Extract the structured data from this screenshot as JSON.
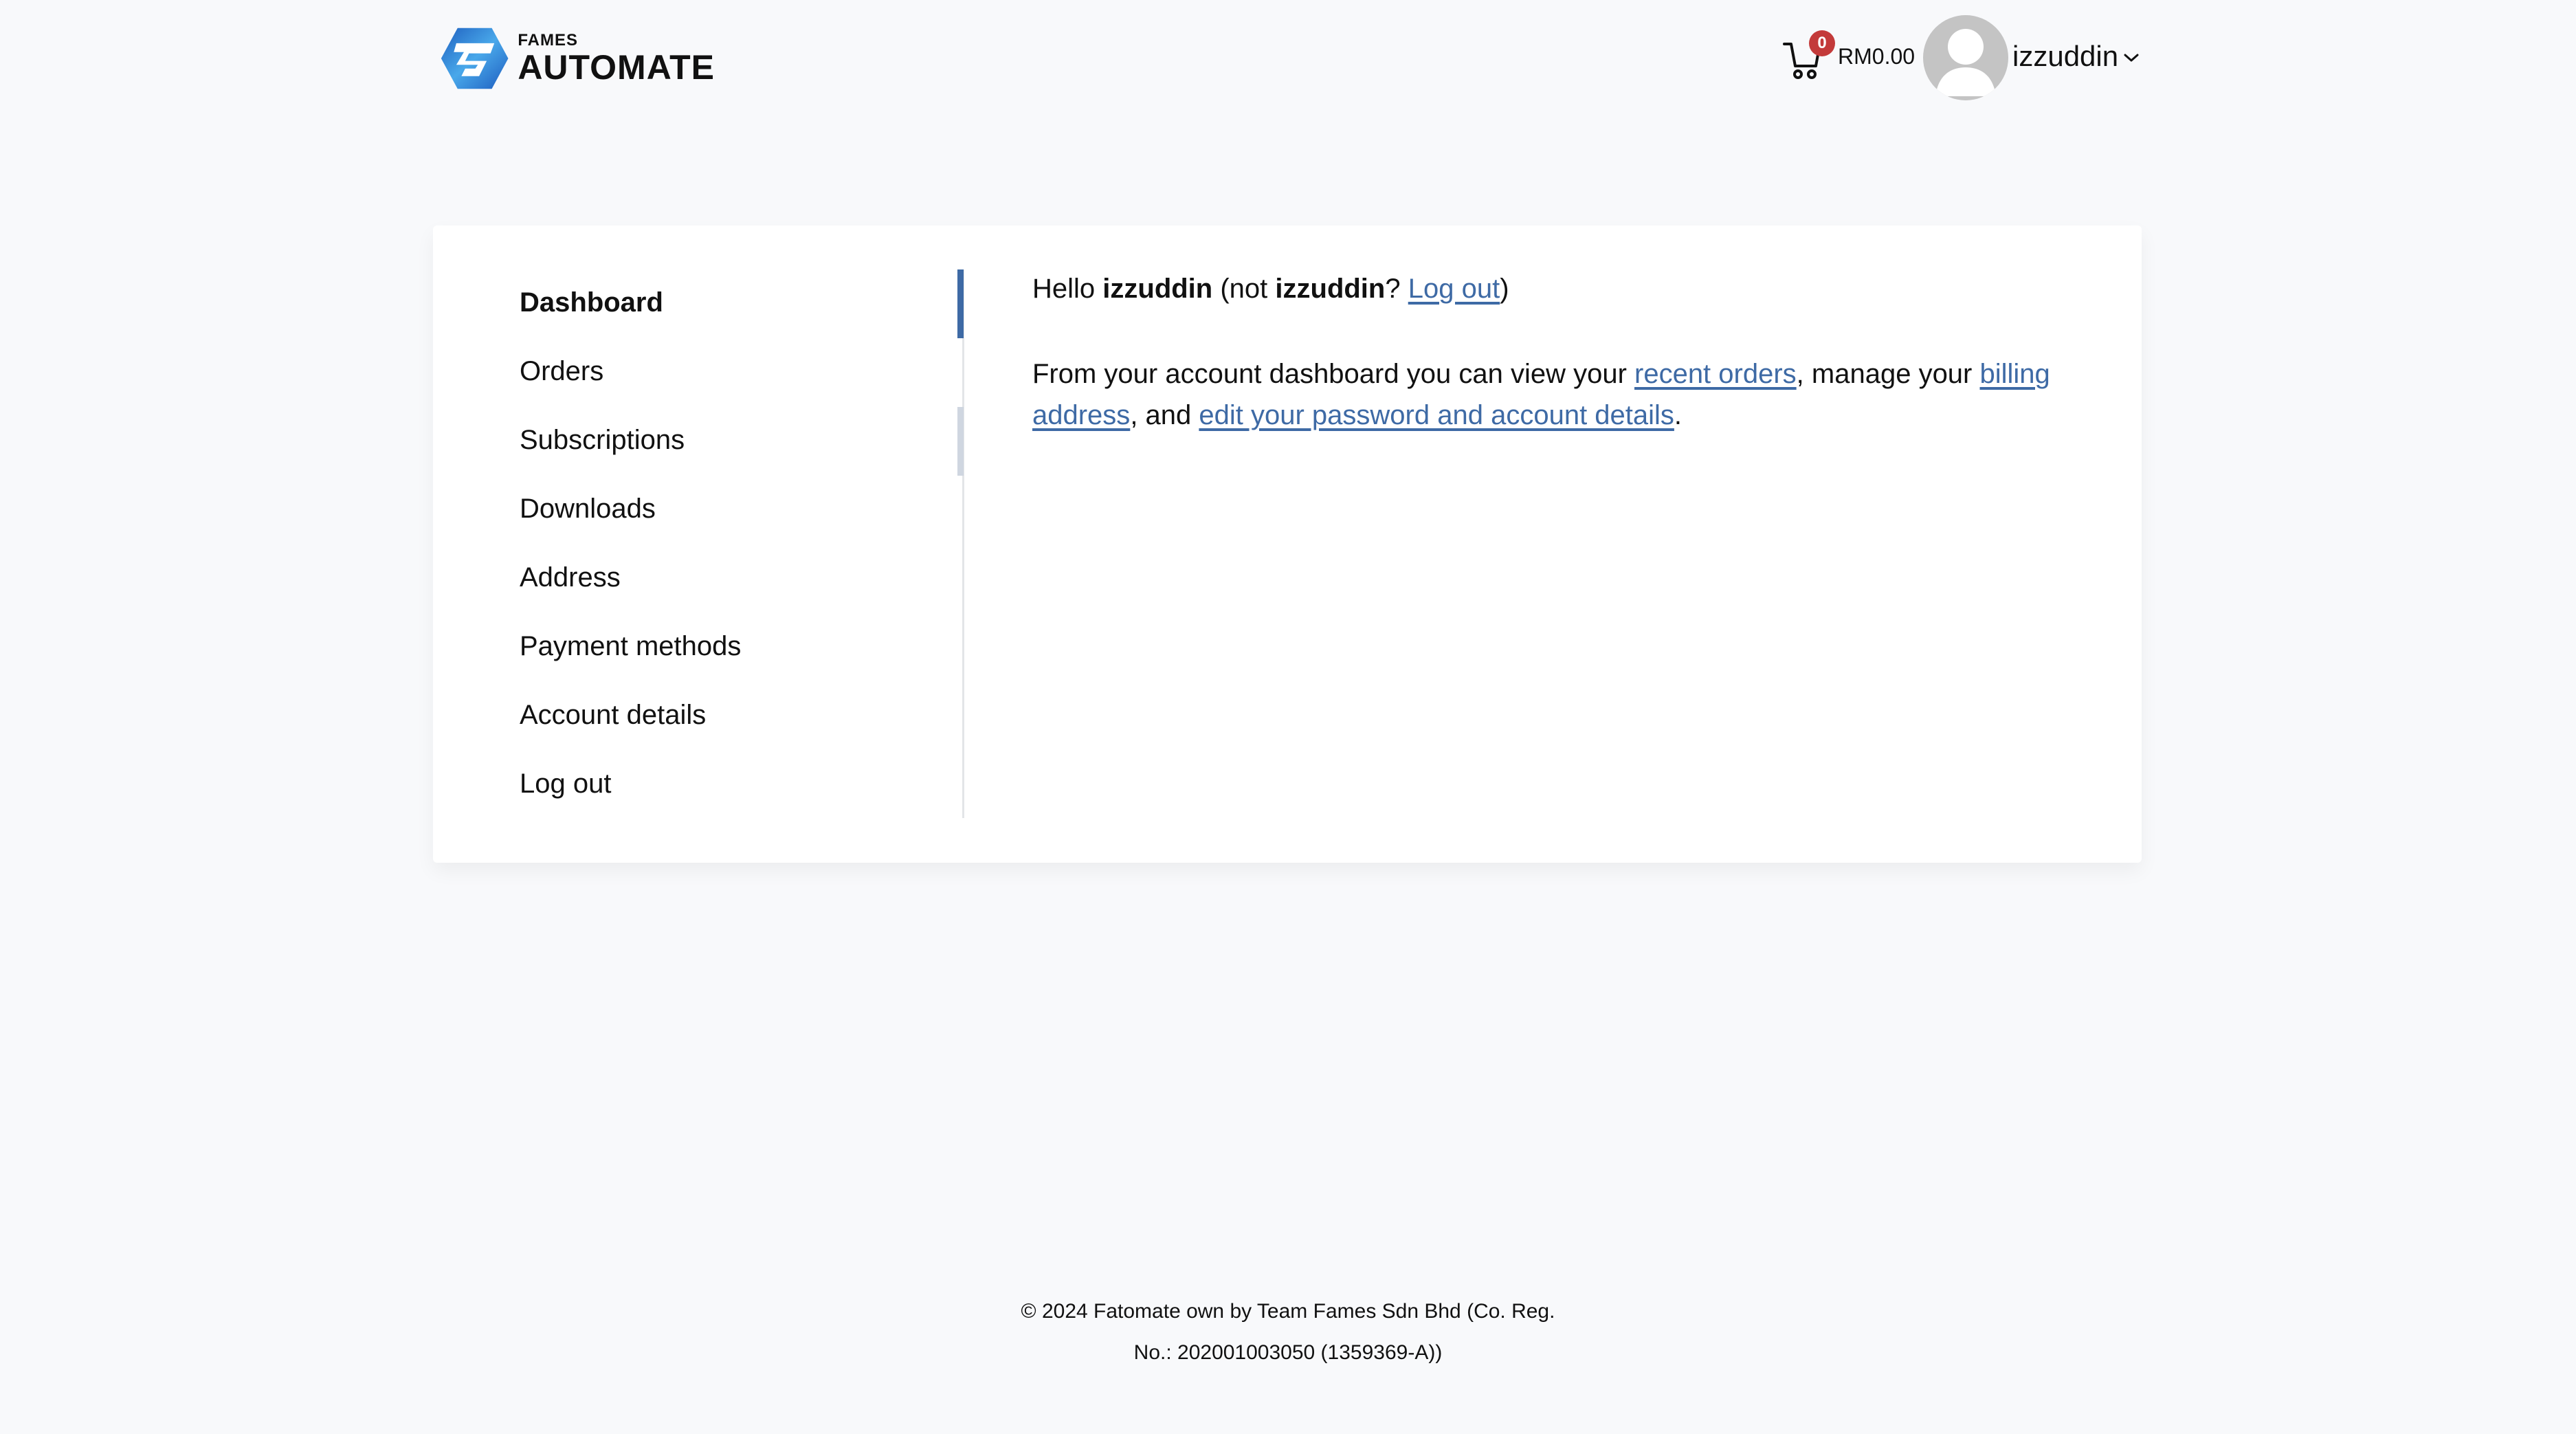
{
  "header": {
    "logo": {
      "brand_small": "FAMES",
      "brand_big": "AUTOMATE",
      "accent_color": "#2f7fd4"
    },
    "cart": {
      "icon": "cart-icon",
      "count": "0",
      "total": "RM0.00",
      "badge_color": "#c33a3a"
    },
    "user": {
      "avatar_icon": "user-avatar-icon",
      "name": "izzuddin",
      "dropdown_icon": "chevron-down-icon"
    }
  },
  "account": {
    "menu": [
      {
        "label": "Dashboard",
        "active": true
      },
      {
        "label": "Orders"
      },
      {
        "label": "Subscriptions",
        "hovered": true
      },
      {
        "label": "Downloads"
      },
      {
        "label": "Address"
      },
      {
        "label": "Payment methods"
      },
      {
        "label": "Account details"
      },
      {
        "label": "Log out"
      }
    ],
    "accent_color": "#3e6aa5",
    "greeting": {
      "hello": "Hello ",
      "username": "izzuddin",
      "not_prefix": " (not ",
      "not_username": "izzuddin",
      "question": "? ",
      "logout_link": "Log out",
      "close_paren": ")"
    },
    "intro": {
      "part1": "From your account dashboard you can view your ",
      "link_recent_orders": "recent orders",
      "part2": ", manage your ",
      "link_billing_address": "billing address",
      "part3": ", and ",
      "link_edit_account": "edit your password and account details",
      "part4": "."
    }
  },
  "footer": {
    "line1": "© 2024 Fatomate own by Team Fames Sdn Bhd (Co. Reg.",
    "line2": "No.: 202001003050 (1359369-A))"
  }
}
